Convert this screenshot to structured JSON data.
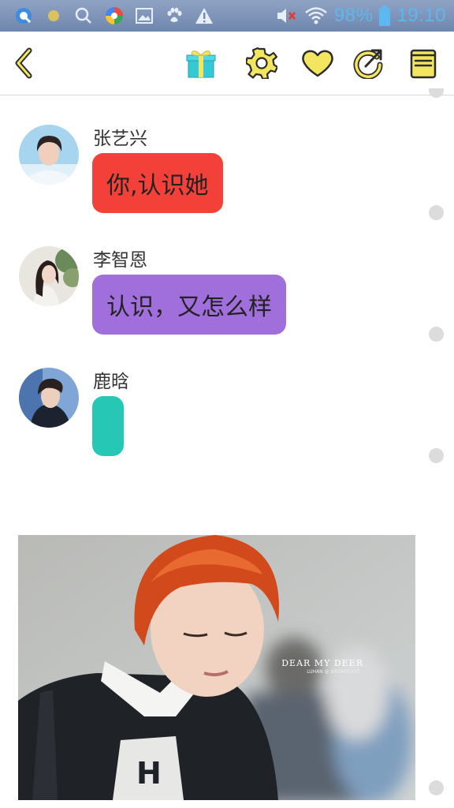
{
  "status_bar": {
    "battery_text": "98%",
    "time": "19:10",
    "icons": [
      "browser-q-icon",
      "dot-icon",
      "search-icon",
      "color-app-icon",
      "gallery-icon",
      "paw-icon",
      "warning-icon",
      "mute-icon",
      "wifi-icon",
      "battery-icon"
    ]
  },
  "toolbar": {
    "icons": [
      "back-icon",
      "gift-icon",
      "settings-icon",
      "heart-icon",
      "share-icon",
      "notes-icon"
    ],
    "accent": "#f2e560"
  },
  "messages": [
    {
      "sender": "张艺兴",
      "text": "你,认识她",
      "bubble_color": "#f3413a"
    },
    {
      "sender": "李智恩",
      "text": "认识，又怎么样",
      "bubble_color": "#a06fdb"
    },
    {
      "sender": "鹿晗",
      "text": "",
      "bubble_color": "#26c7b4"
    }
  ],
  "photo": {
    "watermark": "DEAR MY DEER",
    "watermark_sub": "LUHAN @ BROADCAST"
  }
}
